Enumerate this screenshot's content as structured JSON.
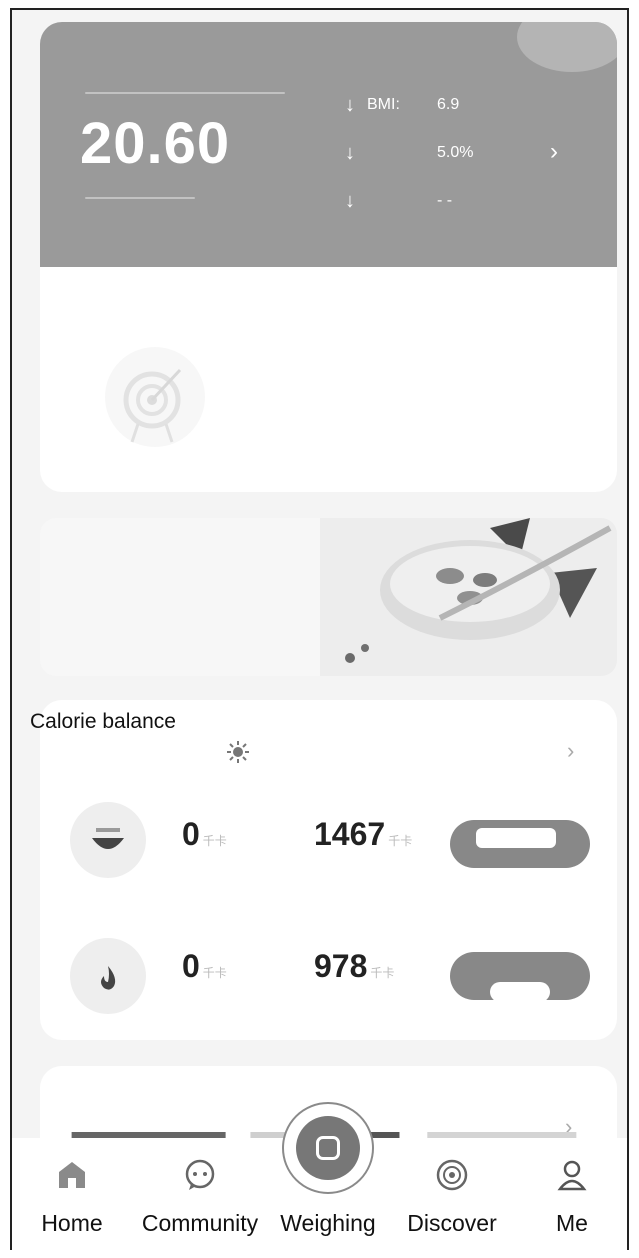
{
  "weight_card": {
    "weight_value": "20.60",
    "stats": [
      {
        "arrow": "↓",
        "label": "BMI:",
        "value": "6.9"
      },
      {
        "arrow": "↓",
        "label": "",
        "value": "5.0%"
      },
      {
        "arrow": "↓",
        "label": "",
        "value": "- -"
      }
    ],
    "chevron": "›"
  },
  "calorie_card": {
    "title": "Calorie balance",
    "chevron": "›",
    "rows": [
      {
        "icon": "bowl-icon",
        "value_left": "0",
        "value_right": "1467"
      },
      {
        "icon": "flame-icon",
        "value_left": "0",
        "value_right": "978"
      }
    ]
  },
  "bottom_card": {
    "chevron": "›",
    "dots": "- - · - - -"
  },
  "nav": {
    "items": [
      {
        "icon": "home-icon",
        "label": "Home"
      },
      {
        "icon": "community-icon",
        "label": "Community"
      },
      {
        "icon": "weighing-icon",
        "label": "Weighing"
      },
      {
        "icon": "discover-icon",
        "label": "Discover"
      },
      {
        "icon": "me-icon",
        "label": "Me"
      }
    ]
  },
  "colors": {
    "header_gray": "#9a9a9a",
    "pill_gray": "#888888",
    "background": "#f4f4f4"
  }
}
